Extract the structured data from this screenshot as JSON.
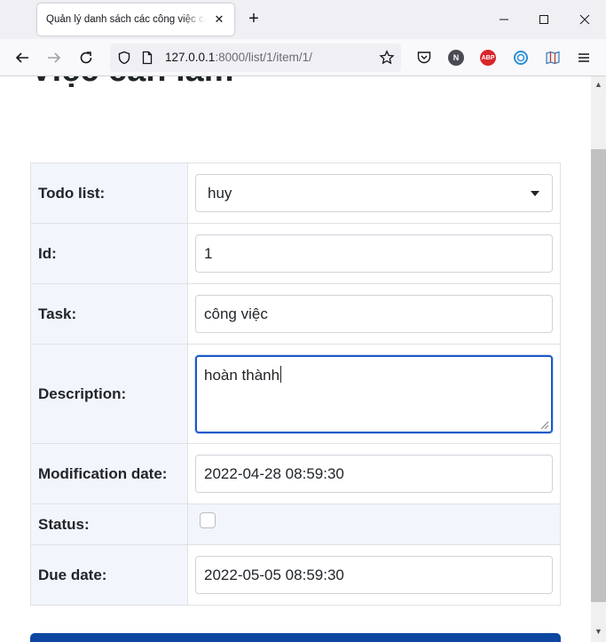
{
  "browser": {
    "tab_title": "Quản lý danh sách các công việc cần làm",
    "url_host": "127.0.0.1",
    "url_path": ":8000/list/1/item/1/",
    "ext_n": "N",
    "ext_abp": "ABP"
  },
  "page": {
    "heading": "Việc cần làm"
  },
  "form": {
    "todo_list_label": "Todo list:",
    "todo_list_value": "huy",
    "id_label": "Id:",
    "id_value": "1",
    "task_label": "Task:",
    "task_value": "công việc",
    "description_label": "Description:",
    "description_value": "hoàn thành",
    "modification_date_label": "Modification date:",
    "modification_date_value": "2022-04-28 08:59:30",
    "status_label": "Status:",
    "status_checked": false,
    "due_date_label": "Due date:",
    "due_date_value": "2022-05-05 08:59:30"
  },
  "colors": {
    "primary": "#0d47a1",
    "focus_border": "#1a5ac8",
    "label_row_bg": "#f2f6fc"
  }
}
